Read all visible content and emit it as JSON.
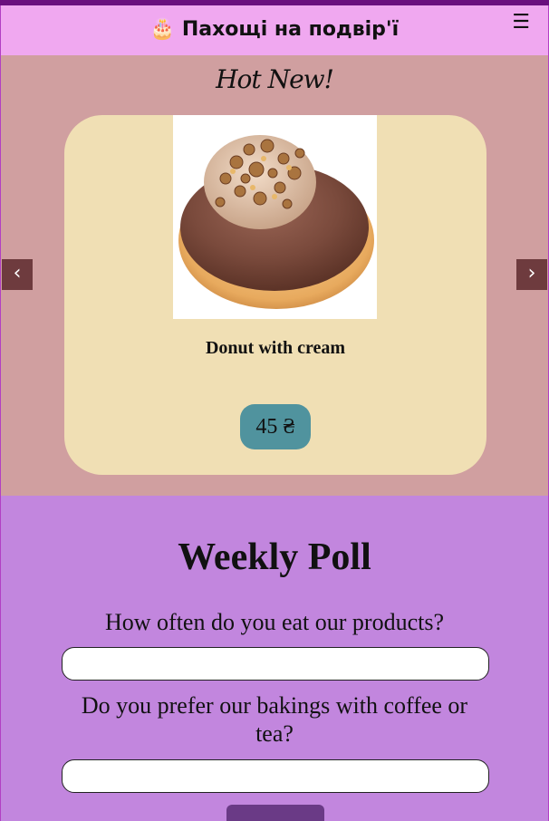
{
  "header": {
    "title": "🎂 Пахощі на подвір'ї",
    "menu_icon": "☰"
  },
  "hero": {
    "heading": "Hot New!",
    "product": {
      "name": "Donut with cream",
      "price": "45 ₴"
    },
    "prev_label": "‹",
    "next_label": "›"
  },
  "poll": {
    "title": "Weekly Poll",
    "questions": [
      "How often do you eat our products?",
      "Do you prefer our bakings with coffee or tea?"
    ]
  },
  "colors": {
    "header_bg": "#f0a8f0",
    "hero_bg": "#d09fa0",
    "card_bg": "#f0dfb4",
    "price_bg": "#50939e",
    "poll_bg": "#c286de",
    "arrow_bg": "#6e3b3e",
    "submit_bg": "#6a3a86"
  }
}
